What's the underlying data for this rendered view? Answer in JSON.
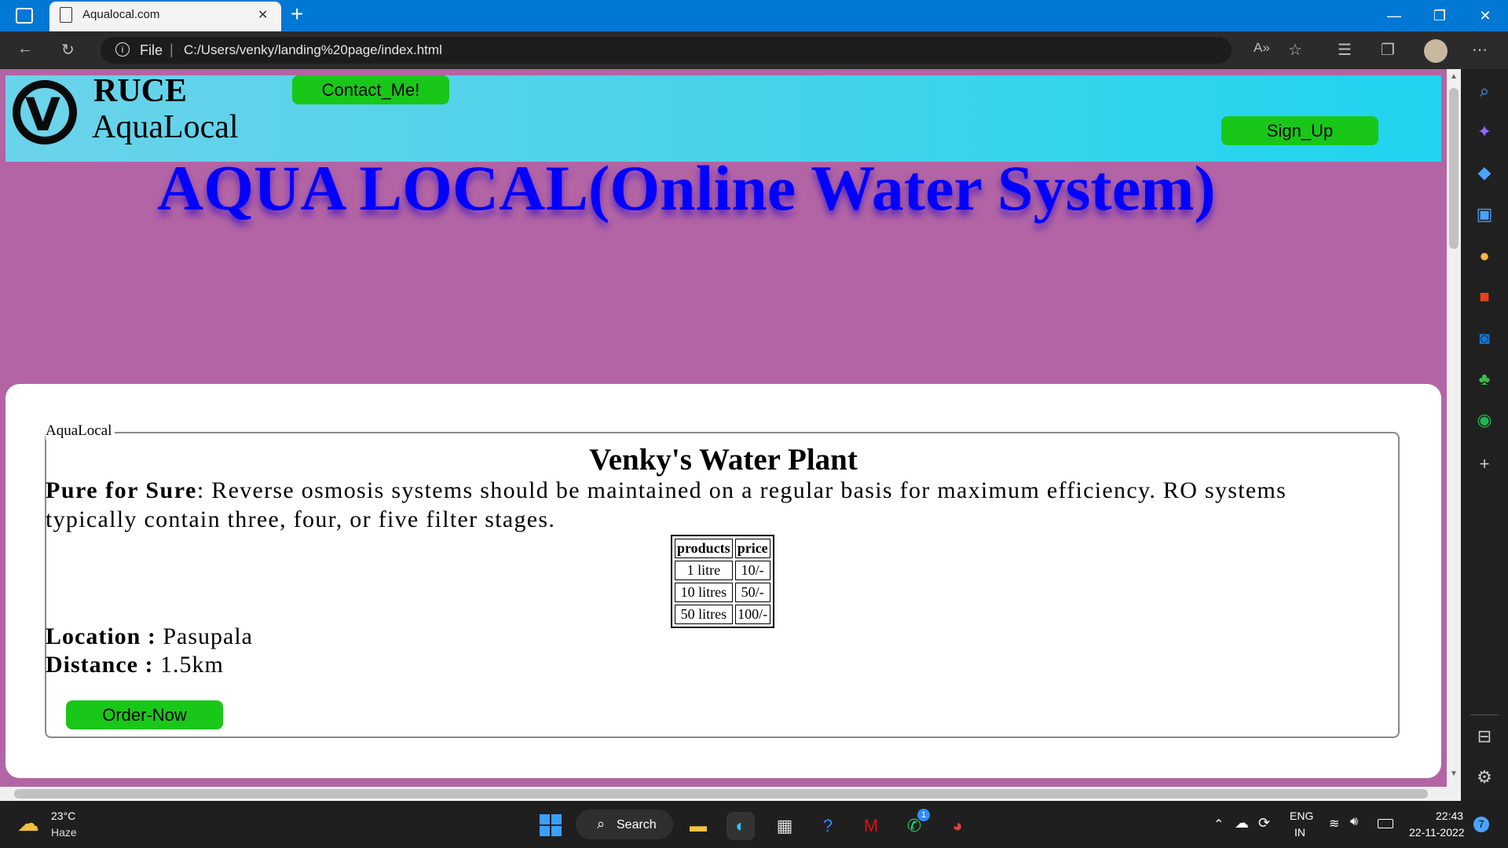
{
  "browser": {
    "tab_title": "Aqualocal.com",
    "tab_close": "✕",
    "new_tab": "+",
    "url_prefix": "File",
    "url": "C:/Users/venky/landing%20page/index.html",
    "window_controls": {
      "minimize": "—",
      "restore": "❐",
      "close": "✕"
    }
  },
  "page": {
    "brand_line1": "RUCE",
    "brand_line2": "AquaLocal",
    "logo_letter": "V",
    "contact_button": "Contact_Me!",
    "signup_button": "Sign_Up",
    "headline": "AQUA LOCAL(Online Water System)",
    "fieldset_legend": "AquaLocal",
    "plant_title": "Venky's Water Plant",
    "desc_bold": "Pure for Sure",
    "desc_text": ": Reverse osmosis systems should be maintained on a regular basis for maximum efficiency. RO systems typically contain three, four, or five filter stages.",
    "table": {
      "headers": [
        "products",
        "price"
      ],
      "rows": [
        [
          "1 litre",
          "10/-"
        ],
        [
          "10 litres",
          "50/-"
        ],
        [
          "50 litres",
          "100/-"
        ]
      ]
    },
    "location_label": "Location : ",
    "location_value": "Pasupala",
    "distance_label": "Distance : ",
    "distance_value": "1.5km",
    "order_button": "Order-Now"
  },
  "taskbar": {
    "weather_temp": "23°C",
    "weather_desc": "Haze",
    "search_label": "Search",
    "lang1": "ENG",
    "lang2": "IN",
    "time": "22:43",
    "date": "22-11-2022",
    "notification_count": "7",
    "whatsapp_badge": "1"
  },
  "colors": {
    "titlebar": "#0078d4",
    "page_bg": "#b364a4",
    "header_cyan": "#47d3ea",
    "button_green": "#19c719",
    "headline_blue": "#0000ff"
  }
}
